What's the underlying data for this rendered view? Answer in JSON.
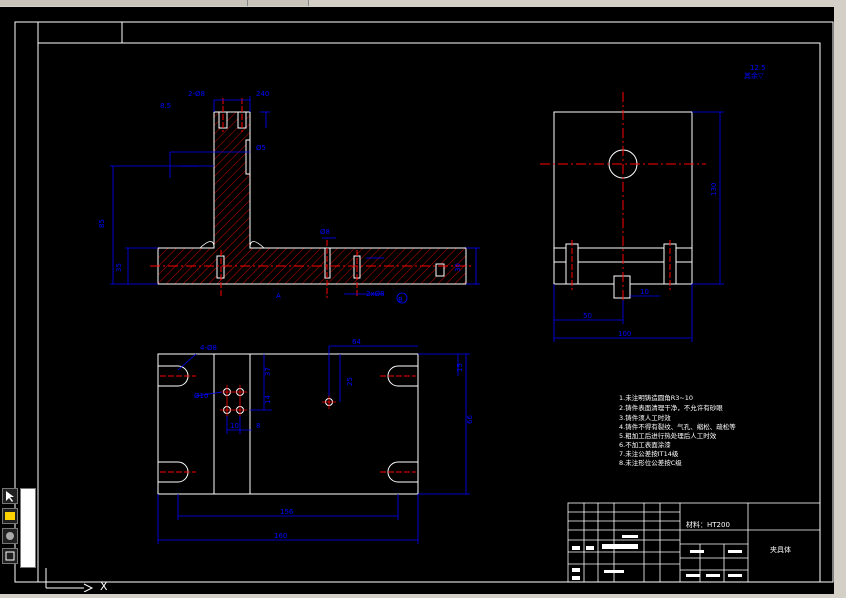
{
  "window": {
    "background": "#000000",
    "chrome_color": "#d4d0c8"
  },
  "drawing": {
    "line_color": "#ffffff",
    "dimension_color": "#0000ff",
    "centerline_color": "#ff0000",
    "hatch_color": "#ff0000",
    "front_view": {
      "dims": [
        "2-Ø8",
        "8.5",
        "0.5",
        "240",
        "Ø5",
        "85",
        "35",
        "Ø8",
        "2xØ8",
        "30"
      ],
      "datum": "A",
      "datum_b": "B"
    },
    "side_view": {
      "roughness": "12.5",
      "roughness_note": "其余▽",
      "dims": [
        "130",
        "50",
        "100",
        "10"
      ]
    },
    "top_view": {
      "dims": [
        "4-Ø8",
        "Ø10",
        "64",
        "37",
        "25",
        "15",
        "14",
        "10",
        "8",
        "66",
        "156",
        "160"
      ]
    },
    "notes": [
      "1.未注明铸造圆角R3~10",
      "2.铸件表面清理干净，不允许有砂眼",
      "3.铸件须人工时效",
      "4.铸件不得有裂纹、气孔、缩松、疏松等",
      "5.粗加工后进行热处理后人工时效",
      "6.不加工表面涂漆",
      "7.未注公差按IT14级",
      "8.未注形位公差按C级"
    ],
    "title_block": {
      "material": "材料：HT200",
      "part_name": "夹具体"
    }
  },
  "toolbar": {
    "icons": [
      "pointer-icon",
      "layer-icon",
      "pan-icon",
      "zoom-icon"
    ]
  }
}
